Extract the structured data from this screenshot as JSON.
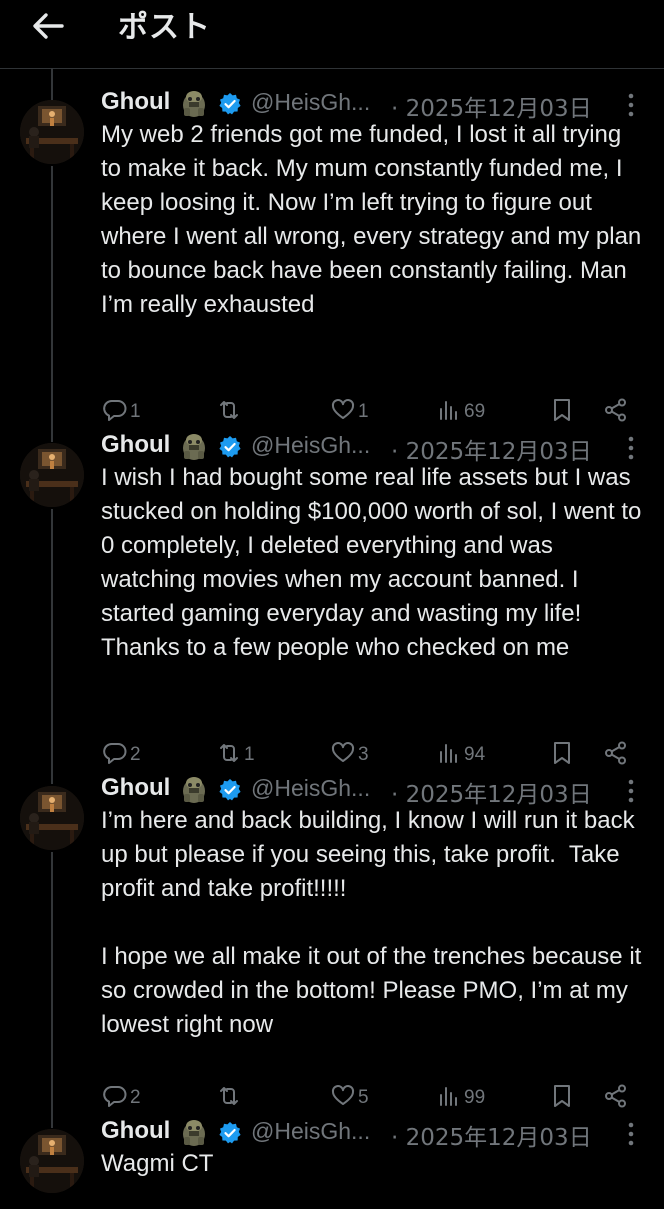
{
  "header": {
    "title": "ポスト"
  },
  "tweets": [
    {
      "name": "Ghoul",
      "handle": "@HeisGh...",
      "date": "· 2025年12月03日",
      "text": "My web 2 friends got me funded, I lost it all trying to make it back. My mum constantly funded me, I keep loosing it. Now I’m left trying to figure out where I went all wrong, every strategy and my plan to bounce back have been constantly failing. Man I’m really exhausted",
      "replies": "1",
      "reposts": "",
      "likes": "1",
      "views": "69"
    },
    {
      "name": "Ghoul",
      "handle": "@HeisGh...",
      "date": "· 2025年12月03日",
      "text": "I wish I had bought some real life assets but I was stucked on holding $100,000 worth of sol, I went to 0 completely, I deleted everything and was watching movies when my account banned. I started gaming everyday and wasting my life! Thanks to a few people who checked on me",
      "replies": "2",
      "reposts": "1",
      "likes": "3",
      "views": "94"
    },
    {
      "name": "Ghoul",
      "handle": "@HeisGh...",
      "date": "· 2025年12月03日",
      "text": "I’m here and back building, I know I will run it back up but please if you seeing this, take profit.  Take profit and take profit!!!!!\n\nI hope we all make it out of the trenches because it so crowded in the bottom! Please PMO, I’m at my lowest right now",
      "replies": "2",
      "reposts": "",
      "likes": "5",
      "views": "99"
    },
    {
      "name": "Ghoul",
      "handle": "@HeisGh...",
      "date": "· 2025年12月03日",
      "text": "Wagmi CT",
      "replies": "",
      "reposts": "",
      "likes": "",
      "views": ""
    }
  ],
  "icons": {
    "back": "arrow-left-icon",
    "verified": "verified-badge-icon",
    "more": "more-vertical-icon",
    "reply": "reply-icon",
    "repost": "repost-icon",
    "like": "heart-icon",
    "views": "views-chart-icon",
    "bookmark": "bookmark-icon",
    "share": "share-icon"
  },
  "colors": {
    "background": "#000000",
    "text": "#e7e9ea",
    "muted": "#71767b",
    "verified": "#1d9bf0",
    "divider": "#2f3336"
  }
}
